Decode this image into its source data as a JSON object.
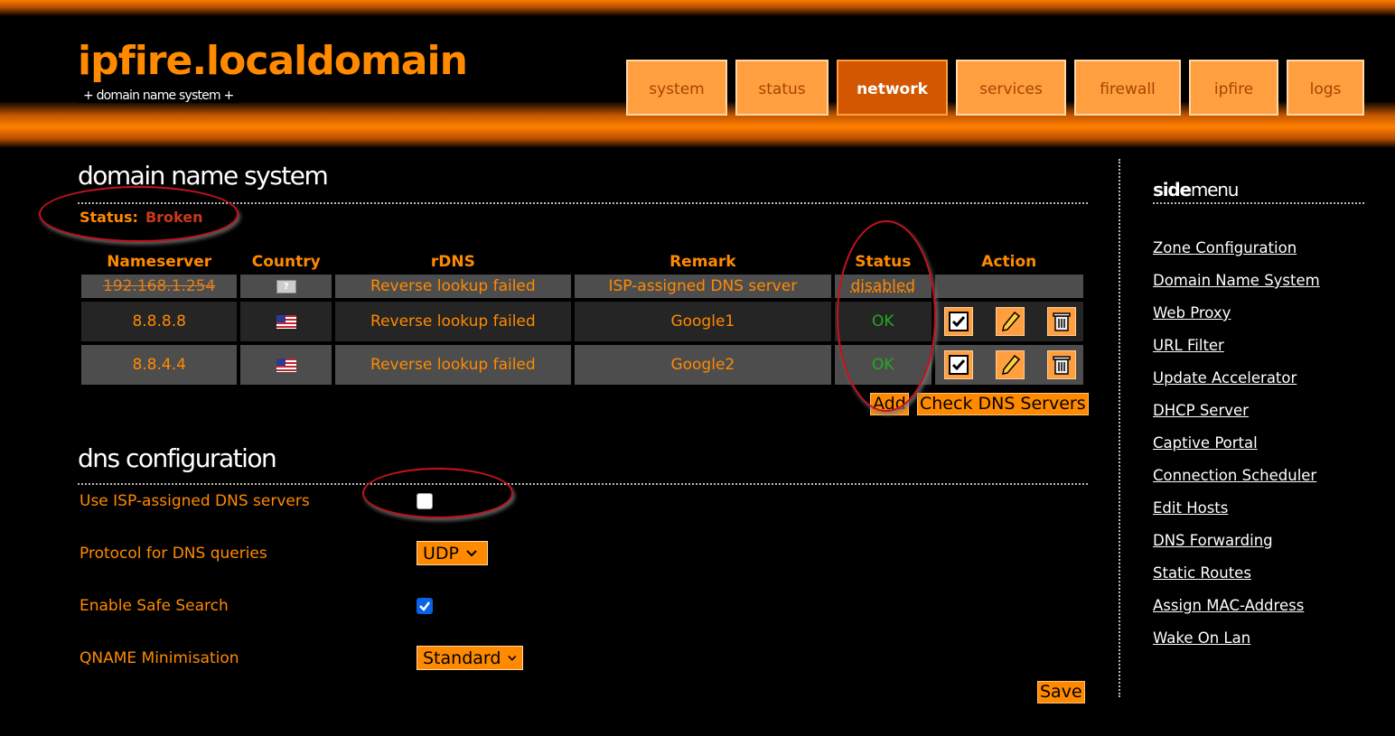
{
  "header": {
    "site_title": "ipfire.localdomain",
    "subtitle": "+ domain name system +",
    "tabs": [
      {
        "label": "system",
        "active": false
      },
      {
        "label": "status",
        "active": false
      },
      {
        "label": "network",
        "active": true
      },
      {
        "label": "services",
        "active": false
      },
      {
        "label": "firewall",
        "active": false
      },
      {
        "label": "ipfire",
        "active": false
      },
      {
        "label": "logs",
        "active": false
      }
    ]
  },
  "dns": {
    "title": "domain name system",
    "status_label": "Status:",
    "status_value": "Broken",
    "columns": [
      "Nameserver",
      "Country",
      "rDNS",
      "Remark",
      "Status",
      "Action"
    ],
    "rows": [
      {
        "nameserver": "192.168.1.254",
        "country_icon": "unknown-flag-icon",
        "rdns": "Reverse lookup failed",
        "remark": "ISP-assigned DNS server",
        "status": "disabled"
      },
      {
        "nameserver": "8.8.8.8",
        "country_icon": "us-flag-icon",
        "rdns": "Reverse lookup failed",
        "remark": "Google1",
        "status": "OK"
      },
      {
        "nameserver": "8.8.4.4",
        "country_icon": "us-flag-icon",
        "rdns": "Reverse lookup failed",
        "remark": "Google2",
        "status": "OK"
      }
    ],
    "add_label": "Add",
    "check_label": "Check DNS Servers"
  },
  "config": {
    "title": "dns configuration",
    "use_isp_label": "Use ISP-assigned DNS servers",
    "use_isp_checked": false,
    "protocol_label": "Protocol for DNS queries",
    "protocol_value": "UDP",
    "safe_search_label": "Enable Safe Search",
    "safe_search_checked": true,
    "qname_label": "QNAME Minimisation",
    "qname_value": "Standard",
    "save_label": "Save"
  },
  "sidemenu": {
    "title_bold": "side",
    "title_rest": "menu",
    "items": [
      "Zone Configuration",
      "Domain Name System",
      "Web Proxy",
      "URL Filter",
      "Update Accelerator",
      "DHCP Server",
      "Captive Portal",
      "Connection Scheduler",
      "Edit Hosts",
      "DNS Forwarding",
      "Static Routes",
      "Assign MAC-Address",
      "Wake On Lan"
    ]
  },
  "colors": {
    "accent": "#ff8a00",
    "tab_bg": "#ff9f3f",
    "tab_active": "#d35600",
    "ok": "#22aa22",
    "broken": "#c83a1a",
    "annotation": "#c8111d"
  }
}
